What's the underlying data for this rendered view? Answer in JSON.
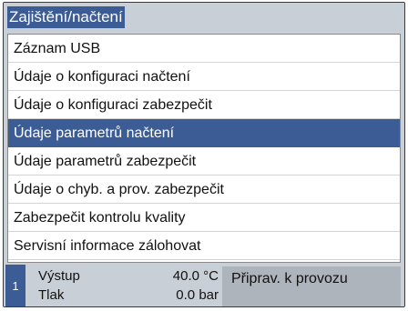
{
  "title": "Zajištění/načtení",
  "menu": {
    "items": [
      {
        "label": "Záznam USB"
      },
      {
        "label": "Údaje o konfiguraci načtení"
      },
      {
        "label": "Údaje o konfiguraci zabezpečit"
      },
      {
        "label": "Údaje parametrů načtení",
        "selected": true
      },
      {
        "label": "Údaje parametrů zabezpečit"
      },
      {
        "label": "Údaje o chyb. a prov. zabezpečit"
      },
      {
        "label": "Zabezpečit kontrolu kvality"
      },
      {
        "label": "Servisní informace zálohovat"
      }
    ]
  },
  "status": {
    "unit": "1",
    "output_label": "Výstup",
    "output_value": "40.0 °C",
    "pressure_label": "Tlak",
    "pressure_value": "0.0 bar",
    "state": "Připrav. k provozu"
  },
  "colors": {
    "accent": "#3c5c96",
    "background": "#c9cfd6",
    "status_panel": "#aeb4bc"
  }
}
